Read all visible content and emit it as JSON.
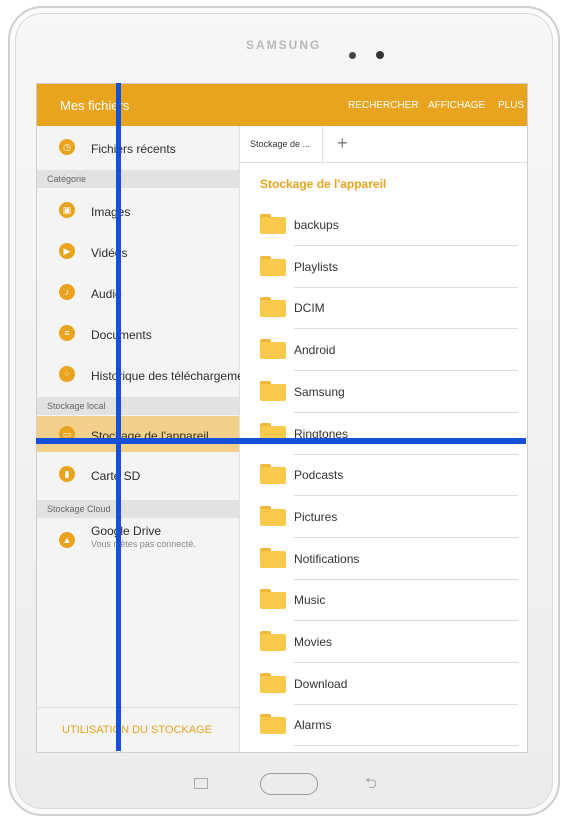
{
  "device": {
    "brand": "SAMSUNG"
  },
  "appbar": {
    "title": "Mes fichiers",
    "actions": [
      "RECHERCHER",
      "AFFICHAGE",
      "PLUS"
    ]
  },
  "sidebar": {
    "recent": "Fichiers récents",
    "section_category": "Catégorie",
    "categories": [
      "Images",
      "Vidéos",
      "Audio",
      "Documents",
      "Historique des téléchargements"
    ],
    "section_local": "Stockage local",
    "local": [
      "Stockage de l'appareil",
      "Carte SD"
    ],
    "section_cloud": "Stockage Cloud",
    "cloud": {
      "name": "Google Drive",
      "status": "Vous n'êtes pas connecté."
    },
    "footer": "UTILISATION DU STOCKAGE"
  },
  "main": {
    "tab_label": "Stockage de ...",
    "add_tab": "+",
    "breadcrumb": "Stockage de l'appareil",
    "folders": [
      "backups",
      "Playlists",
      "DCIM",
      "Android",
      "Samsung",
      "Ringtones",
      "Podcasts",
      "Pictures",
      "Notifications",
      "Music",
      "Movies",
      "Download",
      "Alarms"
    ]
  },
  "colors": {
    "accent": "#e8a31f",
    "selected": "#f3d089",
    "overlay_lines": "#1450d8"
  }
}
